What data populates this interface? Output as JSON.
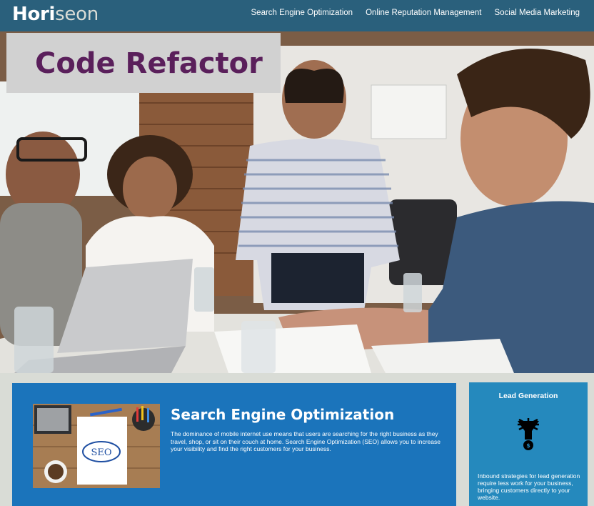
{
  "header": {
    "logo_main": "Hori",
    "logo_accent": "seon",
    "nav": [
      {
        "label": "Search Engine Optimization"
      },
      {
        "label": "Online Reputation Management"
      },
      {
        "label": "Social Media Marketing"
      }
    ]
  },
  "hero": {
    "banner_text": "Code Refactor"
  },
  "content": {
    "seo": {
      "title": "Search Engine Optimization",
      "body": "The dominance of mobile internet use means that users are searching for the right business as they travel, shop, or sit on their couch at home. Search Engine Optimization (SEO) allows you to increase your visibility and find the right customers for your business.",
      "image_text": "SEO"
    }
  },
  "aside": {
    "title": "Lead Generation",
    "body": "Inbound strategies for lead generation require less work for your business, bringing customers directly to your website.",
    "icon": "lead-funnel-icon"
  },
  "colors": {
    "header_bg": "#2a607c",
    "banner_text": "#5a1f5b",
    "seo_card_bg": "#1b74bb",
    "aside_bg": "#2589bd",
    "page_bg": "#d9dcd6"
  }
}
